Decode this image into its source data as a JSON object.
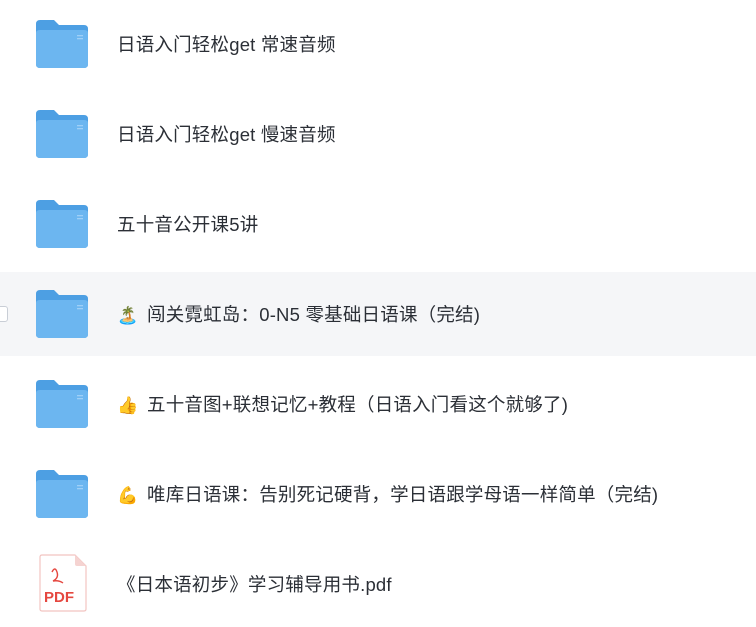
{
  "files": [
    {
      "type": "folder",
      "icon": "folder-icon",
      "emoji": "",
      "name": "日语入门轻松get 常速音频"
    },
    {
      "type": "folder",
      "icon": "folder-icon",
      "emoji": "",
      "name": "日语入门轻松get 慢速音频"
    },
    {
      "type": "folder",
      "icon": "folder-icon",
      "emoji": "",
      "name": "五十音公开课5讲"
    },
    {
      "type": "folder",
      "icon": "folder-icon",
      "emoji": "🏝️",
      "name": "闯关霓虹岛：0-N5 零基础日语课（完结)"
    },
    {
      "type": "folder",
      "icon": "folder-icon",
      "emoji": "👍",
      "name": "五十音图+联想记忆+教程（日语入门看这个就够了)"
    },
    {
      "type": "folder",
      "icon": "folder-icon",
      "emoji": "💪",
      "name": "唯库日语课：告别死记硬背，学日语跟学母语一样简单（完结)"
    },
    {
      "type": "pdf",
      "icon": "pdf-file-icon",
      "emoji": "",
      "name": "《日本语初步》学习辅导用书.pdf",
      "badge": "PDF"
    }
  ],
  "colors": {
    "folder_front": "#6cb6f0",
    "folder_back": "#4d9fe3",
    "pdf_red": "#e5473f",
    "hover_bg": "#f5f6f8",
    "text": "#2b2f36"
  }
}
